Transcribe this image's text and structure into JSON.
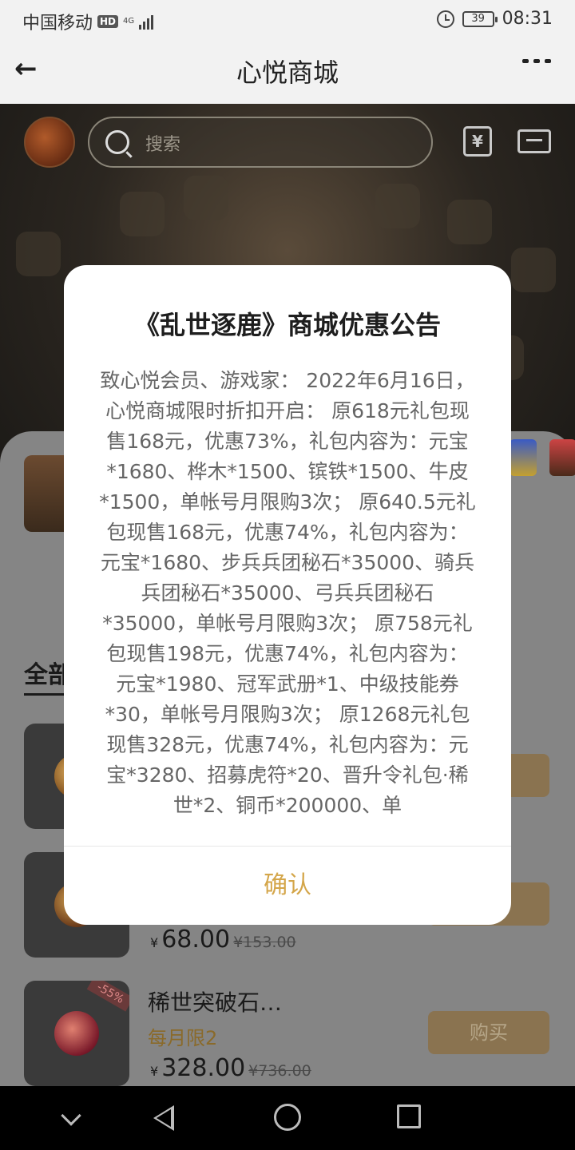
{
  "status_bar": {
    "carrier": "中国移动",
    "hd": "HD",
    "network": "4G",
    "battery": "39",
    "time": "08:31"
  },
  "header": {
    "title": "心悦商城"
  },
  "search": {
    "placeholder": "搜索"
  },
  "tabs": {
    "all_label": "全部"
  },
  "products": [
    {
      "price_currency": "¥",
      "price": "68.00",
      "original_price": "¥153.00"
    },
    {
      "name": "稀世突破石…",
      "limit": "每月限2",
      "price_currency": "¥",
      "price": "328.00",
      "original_price": "¥736.00",
      "discount": "-55%",
      "buy_label": "购买"
    }
  ],
  "dialog": {
    "title": "《乱世逐鹿》商城优惠公告",
    "body": "致心悦会员、游戏家： 2022年6月16日，心悦商城限时折扣开启： 原618元礼包现售168元，优惠73%，礼包内容为：元宝*1680、桦木*1500、镔铁*1500、牛皮*1500，单帐号月限购3次； 原640.5元礼包现售168元，优惠74%，礼包内容为：元宝*1680、步兵兵团秘石*35000、骑兵兵团秘石*35000、弓兵兵团秘石*35000，单帐号月限购3次； 原758元礼包现售198元，优惠74%，礼包内容为：元宝*1980、冠军武册*1、中级技能券*30，单帐号月限购3次； 原1268元礼包现售328元，优惠74%，礼包内容为：元宝*3280、招募虎符*20、晋升令礼包·稀世*2、铜币*200000、单",
    "confirm_label": "确认"
  }
}
